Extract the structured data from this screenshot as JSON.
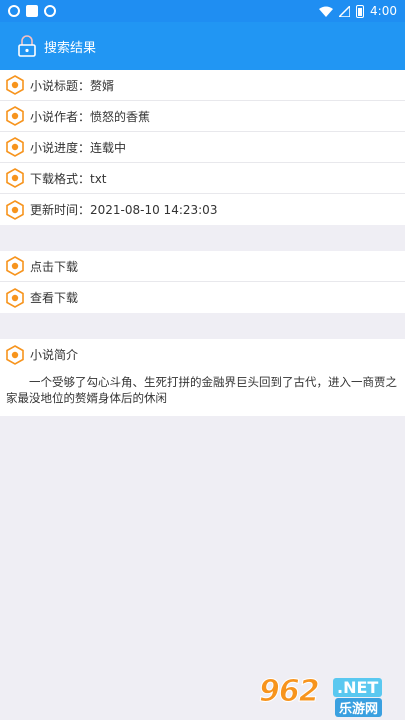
{
  "status_bar": {
    "time": "4:00",
    "battery_level": 0.7
  },
  "app_bar": {
    "title": "搜索结果",
    "icon": "lock-icon"
  },
  "accent_color": "#2196f3",
  "hex_icon_color": "#f7941d",
  "details": {
    "title_row": "小说标题：赘婿",
    "author_row": "小说作者：愤怒的香蕉",
    "progress_row": "小说进度：连载中",
    "format_row": "下载格式：txt",
    "updated_row": "更新时间：2021-08-10 14:23:03"
  },
  "actions": {
    "download": "点击下载",
    "view_downloads": "查看下载"
  },
  "intro": {
    "heading": "小说简介",
    "text": "一个受够了勾心斗角、生死打拼的金融界巨头回到了古代，进入一商贾之家最没地位的赘婿身体后的休闲"
  },
  "watermark": {
    "number": "962",
    "suffix": ".NET",
    "site": "乐游网"
  }
}
